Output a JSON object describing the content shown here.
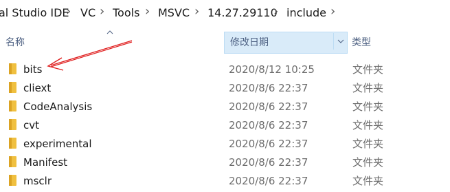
{
  "breadcrumb": {
    "items": [
      "al Studio IDE",
      "VC",
      "Tools",
      "MSVC",
      "14.27.29110",
      "include"
    ],
    "separator": ">"
  },
  "columns": {
    "name": "名称",
    "date": "修改日期",
    "type": "类型",
    "sort_indicator": "^",
    "date_dropdown": "v"
  },
  "files": [
    {
      "name": "bits",
      "date": "2020/8/12 10:25",
      "type": "文件夹"
    },
    {
      "name": "cliext",
      "date": "2020/8/6 22:37",
      "type": "文件夹"
    },
    {
      "name": "CodeAnalysis",
      "date": "2020/8/6 22:37",
      "type": "文件夹"
    },
    {
      "name": "cvt",
      "date": "2020/8/6 22:37",
      "type": "文件夹"
    },
    {
      "name": "experimental",
      "date": "2020/8/6 22:37",
      "type": "文件夹"
    },
    {
      "name": "Manifest",
      "date": "2020/8/6 22:37",
      "type": "文件夹"
    },
    {
      "name": "msclr",
      "date": "2020/8/6 22:37",
      "type": "文件夹"
    }
  ],
  "colors": {
    "folder": "#f0c040",
    "folder_dark": "#dba323",
    "header_selected": "#d9ebf9",
    "header_text": "#4d6082",
    "annotation_arrow": "#e02020"
  },
  "icons": {
    "folder": "folder-icon",
    "sort": "sort-up-icon",
    "dropdown": "chevron-down-icon",
    "breadcrumb_sep": "chevron-right-icon"
  }
}
